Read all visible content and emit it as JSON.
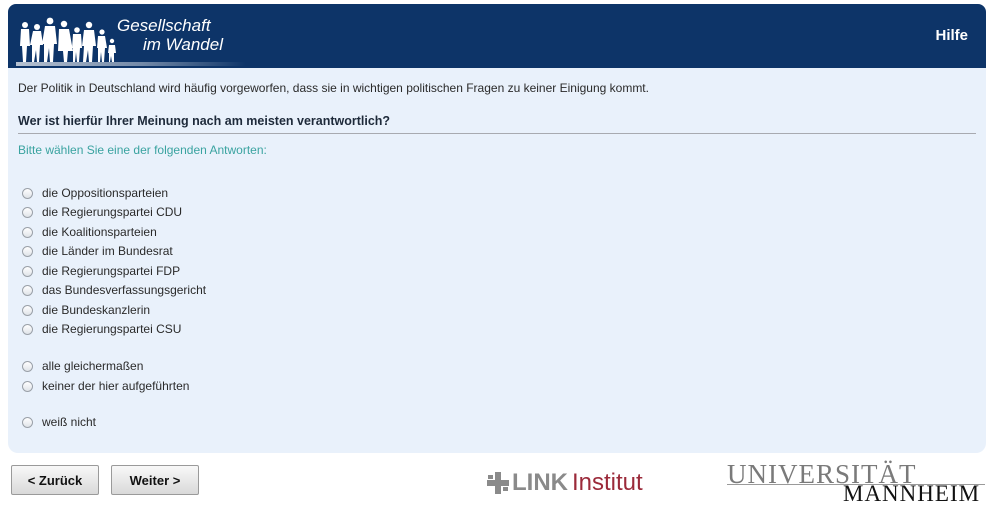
{
  "header": {
    "logo_line1": "Gesellschaft",
    "logo_line2": "im Wandel",
    "help_label": "Hilfe",
    "bg_color": "#0d3468"
  },
  "survey": {
    "intro": "Der Politik in Deutschland wird häufig vorgeworfen, dass sie in wichtigen politischen Fragen zu keiner Einigung kommt.",
    "question": "Wer ist hierfür Ihrer Meinung nach am meisten verantwortlich?",
    "instruction": "Bitte wählen Sie eine der folgenden Antworten:",
    "options": [
      "die Oppositionsparteien",
      "die Regierungspartei CDU",
      "die Koalitionsparteien",
      "die Länder im Bundesrat",
      "die Regierungspartei FDP",
      "das Bundesverfassungsgericht",
      "die Bundeskanzlerin",
      "die Regierungspartei CSU",
      "alle gleichermaßen",
      "keiner der hier aufgeführten",
      "weiß nicht"
    ]
  },
  "nav": {
    "back_label": "< Zurück",
    "next_label": "Weiter >"
  },
  "footer": {
    "link_word": "LINK",
    "institut_word": "Institut",
    "uni_line1": "UNIVERSITÄT",
    "uni_line2": "MANNHEIM"
  }
}
